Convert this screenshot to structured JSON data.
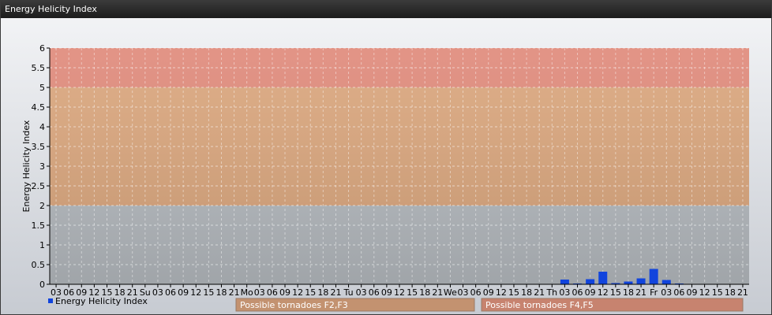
{
  "window": {
    "title": "Energy Helicity Index"
  },
  "chart_data": {
    "type": "bar",
    "ylabel": "Energy Helicity Index",
    "xlabel": "",
    "ylim": [
      0,
      6
    ],
    "yticks": [
      "0",
      "0.5",
      "1",
      "1.5",
      "2",
      "2.5",
      "3",
      "3.5",
      "4",
      "4.5",
      "5",
      "5.5",
      "6"
    ],
    "grid": true,
    "categories": [
      "03",
      "06",
      "09",
      "12",
      "15",
      "18",
      "21",
      "Su",
      "03",
      "06",
      "09",
      "12",
      "15",
      "18",
      "21",
      "Mo",
      "03",
      "06",
      "09",
      "12",
      "15",
      "18",
      "21",
      "Tu",
      "03",
      "06",
      "09",
      "12",
      "15",
      "18",
      "21",
      "We",
      "03",
      "06",
      "09",
      "12",
      "15",
      "18",
      "21",
      "Th",
      "03",
      "06",
      "09",
      "12",
      "15",
      "18",
      "21",
      "Fr",
      "03",
      "06",
      "09",
      "12",
      "15",
      "18",
      "21"
    ],
    "series": [
      {
        "name": "Energy Helicity Index",
        "color": "#1144dd",
        "values": [
          0.01,
          0.01,
          0.01,
          0.01,
          0.01,
          0.01,
          0.01,
          0.01,
          0.01,
          0.01,
          0.01,
          0.01,
          0.01,
          0.01,
          0.01,
          0.01,
          0.01,
          0.01,
          0.01,
          0.01,
          0.01,
          0.01,
          0.01,
          0.01,
          0.01,
          0.01,
          0.01,
          0.01,
          0.01,
          0.01,
          0.01,
          0.01,
          0.01,
          0.01,
          0.01,
          0.01,
          0.01,
          0.01,
          0.01,
          0.01,
          0.12,
          0.02,
          0.13,
          0.32,
          0.03,
          0.07,
          0.15,
          0.39,
          0.11,
          0.02,
          0.01,
          0.01,
          0.01,
          0.01,
          0.01
        ]
      }
    ],
    "bands": [
      {
        "from": 0,
        "to": 2,
        "color": "#b6bbc0"
      },
      {
        "from": 2,
        "to": 5,
        "color": "#dba77e",
        "label": "Possible tornadoes F2,F3",
        "label_color": "#c39270"
      },
      {
        "from": 5,
        "to": 6,
        "color": "#e08b7c",
        "label": "Possible tornadoes F4,F5",
        "label_color": "#c7836f"
      }
    ],
    "legend": {
      "placement": "bottom-left",
      "label": "Energy Helicity Index"
    }
  }
}
